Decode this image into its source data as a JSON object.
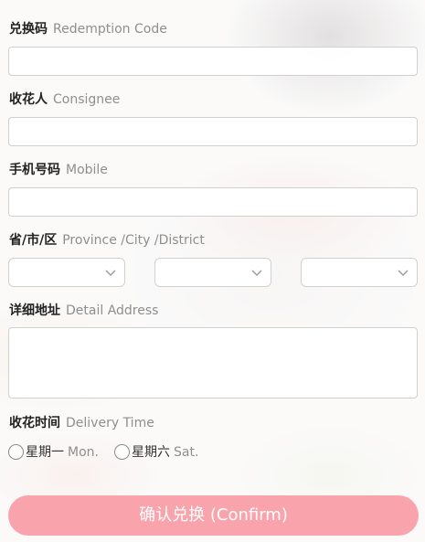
{
  "form": {
    "redemption": {
      "zh": "兑换码",
      "en": "Redemption Code",
      "value": ""
    },
    "consignee": {
      "zh": "收花人",
      "en": "Consignee",
      "value": ""
    },
    "mobile": {
      "zh": "手机号码",
      "en": "Mobile",
      "value": ""
    },
    "region": {
      "zh": "省/市/区",
      "en": "Province /City /District",
      "province": "",
      "city": "",
      "district": ""
    },
    "address": {
      "zh": "详细地址",
      "en": "Detail Address",
      "value": ""
    },
    "delivery": {
      "zh": "收花时间",
      "en": "Delivery Time",
      "options": [
        {
          "zh": "星期一",
          "en": "Mon."
        },
        {
          "zh": "星期六",
          "en": "Sat."
        }
      ]
    }
  },
  "confirm_label": "确认兑换 (Confirm)",
  "colors": {
    "confirm_bg": "#f9a3ad",
    "border": "#d0d0d0",
    "label_en": "#8e8e8e"
  },
  "icons": {
    "select_caret": "chevron-down-icon",
    "radio": "radio-circle-icon"
  }
}
